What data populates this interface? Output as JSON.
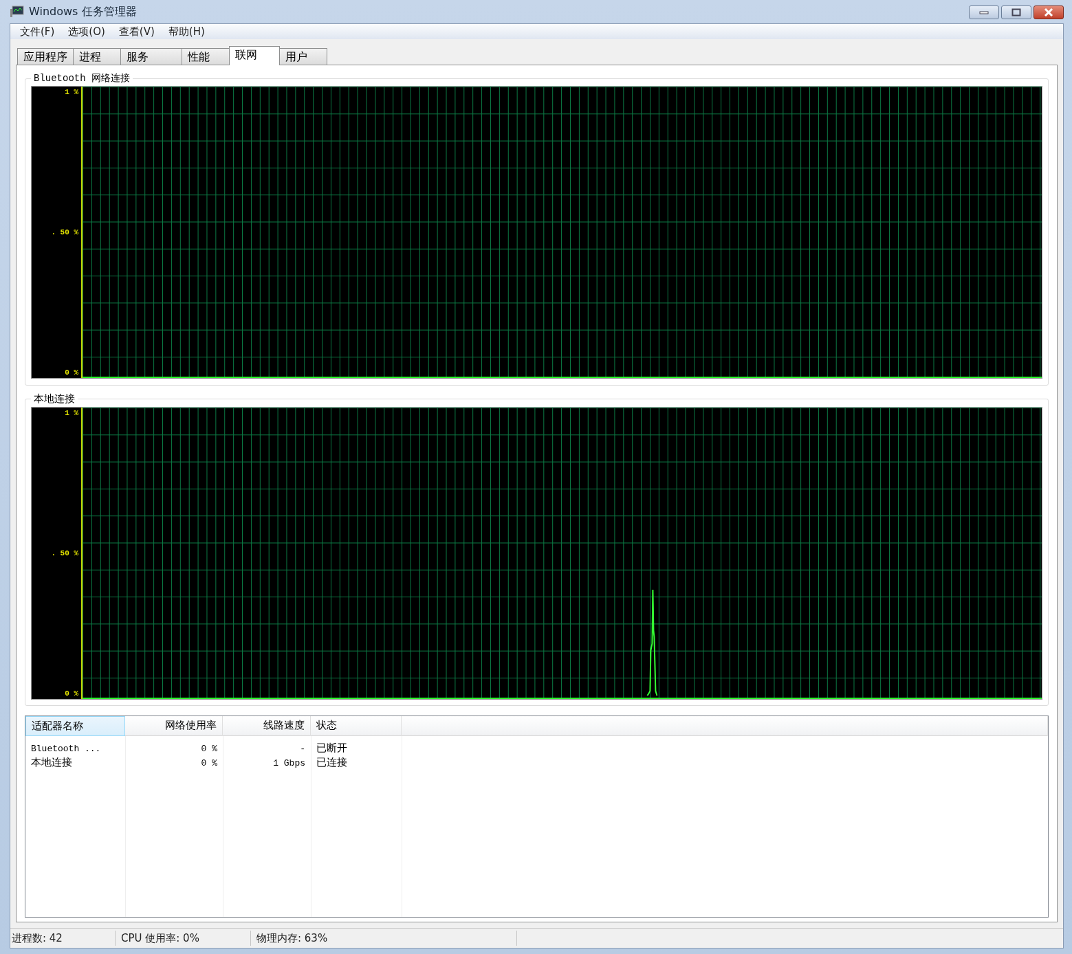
{
  "window": {
    "title": "Windows 任务管理器"
  },
  "menu": [
    "文件(F)",
    "选项(O)",
    "查看(V)",
    "帮助(H)"
  ],
  "tabs": [
    {
      "label": "应用程序",
      "selected": false
    },
    {
      "label": "进程",
      "selected": false
    },
    {
      "label": "服务",
      "selected": false
    },
    {
      "label": "性能",
      "selected": false
    },
    {
      "label": "联网",
      "selected": true
    },
    {
      "label": "用户",
      "selected": false
    }
  ],
  "graphs": [
    {
      "title": "Bluetooth 网络连接",
      "y_labels": [
        "1 %",
        ". 50 %",
        "0 %"
      ],
      "spike": false
    },
    {
      "title": "本地连接",
      "y_labels": [
        "1 %",
        ". 50 %",
        "0 %"
      ],
      "spike": true
    }
  ],
  "table": {
    "columns": [
      "适配器名称",
      "网络使用率",
      "线路速度",
      "状态"
    ],
    "rows": [
      [
        "Bluetooth ...",
        "0 %",
        "-",
        "已断开"
      ],
      [
        "本地连接",
        "0 %",
        "1 Gbps",
        "已连接"
      ]
    ]
  },
  "status_bar": [
    "进程数: 42",
    "CPU 使用率: 0%",
    "物理内存: 63%"
  ]
}
